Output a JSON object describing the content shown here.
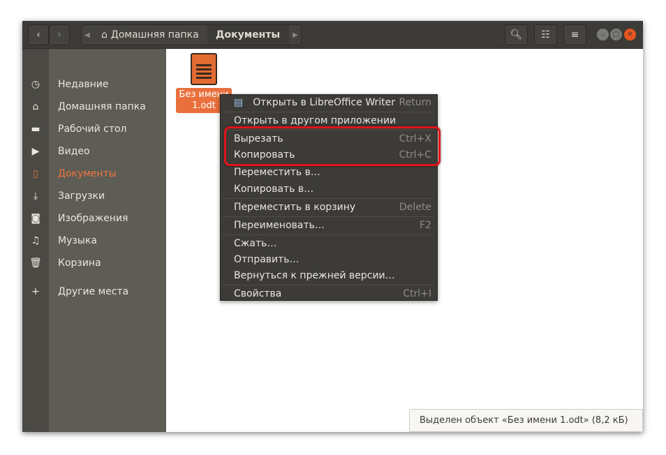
{
  "breadcrumb": {
    "home": "Домашняя папка",
    "current": "Документы"
  },
  "sidebar": {
    "items": [
      {
        "label": "Недавние",
        "icon": "clock-icon"
      },
      {
        "label": "Домашняя папка",
        "icon": "home-icon"
      },
      {
        "label": "Рабочий стол",
        "icon": "folder-icon"
      },
      {
        "label": "Видео",
        "icon": "video-icon"
      },
      {
        "label": "Документы",
        "icon": "document-icon",
        "active": true
      },
      {
        "label": "Загрузки",
        "icon": "download-icon"
      },
      {
        "label": "Изображения",
        "icon": "camera-icon"
      },
      {
        "label": "Музыка",
        "icon": "music-icon"
      },
      {
        "label": "Корзина",
        "icon": "trash-icon"
      },
      {
        "label": "Другие места",
        "icon": "plus-icon"
      }
    ]
  },
  "file": {
    "name": "Без имени 1.odt"
  },
  "menu": {
    "items": [
      {
        "label": "Открыть в LibreOffice Writer",
        "shortcut": "Return"
      },
      {
        "label": "Открыть в другом приложении",
        "shortcut": ""
      },
      {
        "label": "Вырезать",
        "shortcut": "Ctrl+X"
      },
      {
        "label": "Копировать",
        "shortcut": "Ctrl+C"
      },
      {
        "label": "Переместить в…",
        "shortcut": ""
      },
      {
        "label": "Копировать в…",
        "shortcut": ""
      },
      {
        "label": "Переместить в корзину",
        "shortcut": "Delete"
      },
      {
        "label": "Переименовать…",
        "shortcut": "F2"
      },
      {
        "label": "Сжать…",
        "shortcut": ""
      },
      {
        "label": "Отправить…",
        "shortcut": ""
      },
      {
        "label": "Вернуться к прежней версии…",
        "shortcut": ""
      },
      {
        "label": "Свойства",
        "shortcut": "Ctrl+I"
      }
    ]
  },
  "status": "Выделен объект «Без имени 1.odt» (8,2 кБ)",
  "colors": {
    "accent": "#e9703c",
    "highlight": "#e0141b",
    "close": "#e95420"
  }
}
